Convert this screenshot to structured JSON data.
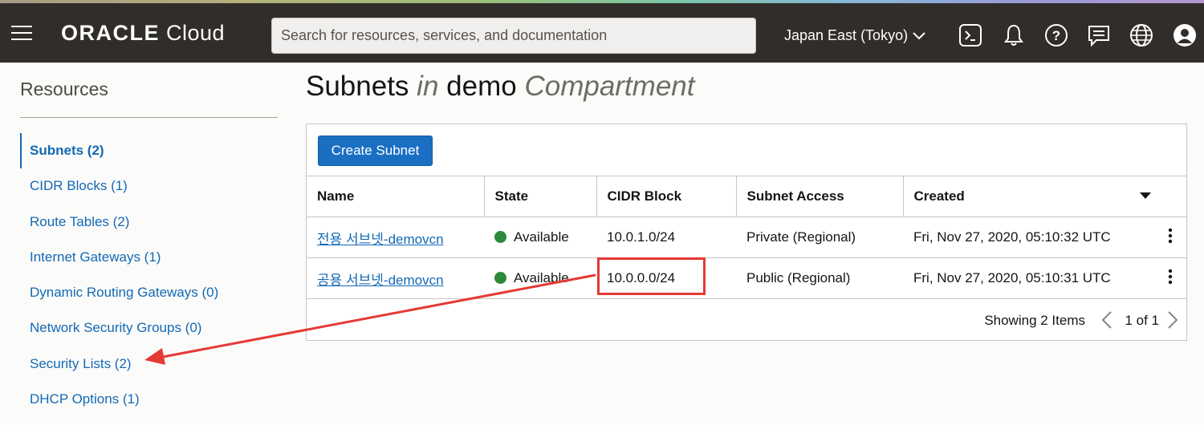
{
  "header": {
    "brand_oracle": "ORACLE",
    "brand_cloud": "Cloud",
    "search_placeholder": "Search for resources, services, and documentation",
    "region": "Japan East (Tokyo)",
    "icons": [
      "menu-icon",
      "cloud-shell-icon",
      "bell-icon",
      "help-icon",
      "chat-icon",
      "globe-icon",
      "user-icon"
    ]
  },
  "sidebar": {
    "title": "Resources",
    "items": [
      {
        "label": "Subnets (2)",
        "active": true
      },
      {
        "label": "CIDR Blocks (1)"
      },
      {
        "label": "Route Tables (2)"
      },
      {
        "label": "Internet Gateways (1)"
      },
      {
        "label": "Dynamic Routing Gateways (0)"
      },
      {
        "label": "Network Security Groups (0)"
      },
      {
        "label": "Security Lists (2)"
      },
      {
        "label": "DHCP Options (1)"
      }
    ]
  },
  "main": {
    "title_subject": "Subnets",
    "title_in": "in",
    "title_compartment_name": "demo",
    "title_compartment_word": "Compartment",
    "create_button": "Create Subnet",
    "columns": [
      "Name",
      "State",
      "CIDR Block",
      "Subnet Access",
      "Created"
    ],
    "rows": [
      {
        "name": "전용 서브넷-demovcn",
        "state": "Available",
        "cidr": "10.0.1.0/24",
        "access": "Private (Regional)",
        "created": "Fri, Nov 27, 2020, 05:10:32 UTC"
      },
      {
        "name": "공용 서브넷-demovcn",
        "state": "Available",
        "cidr": "10.0.0.0/24",
        "access": "Public (Regional)",
        "created": "Fri, Nov 27, 2020, 05:10:31 UTC"
      }
    ],
    "showing": "Showing 2 Items",
    "pager": "1 of 1"
  },
  "colors": {
    "header_bg": "#312d2a",
    "link": "#1369b5",
    "primary_button": "#1a6fc3",
    "status_available": "#2c8a3a",
    "annotation_red": "#e53935"
  }
}
